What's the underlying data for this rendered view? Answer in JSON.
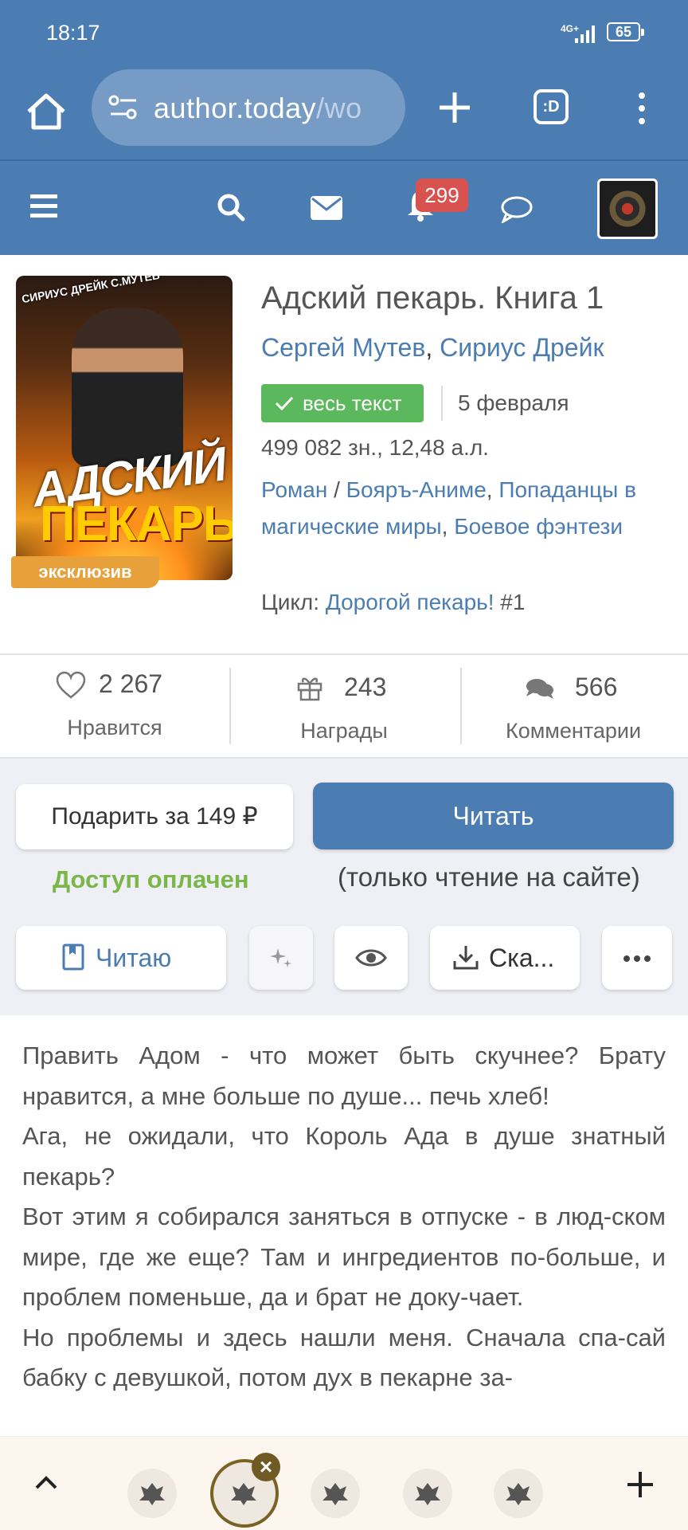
{
  "status_bar": {
    "time": "18:17",
    "network": "4G+",
    "battery": "65"
  },
  "browser": {
    "url_main": "author.today",
    "url_rest": "/wo",
    "ext_label": ":D"
  },
  "site_nav": {
    "notifications_count": "299"
  },
  "book": {
    "title": "Адский пекарь. Книга 1",
    "authors": [
      "Сергей Мутев",
      "Сириус Дрейк"
    ],
    "author_separator": ", ",
    "cover_badge": "эксклюзив",
    "cover_title_line1": "АДСКИЙ",
    "cover_title_line2": "ПЕКАРЬ",
    "cover_authors": "СИРИУС ДРЕЙК С.МУТЕВ",
    "status_badge": "весь текст",
    "date": "5 февраля",
    "size": "499 082 зн., 12,48 а.л.",
    "genre_main": "Роман",
    "genre_slash": " / ",
    "genre_1": "Бояръ-Аниме",
    "genre_2": "Попаданцы в магические миры",
    "genre_3": "Боевое фэнтези",
    "genre_comma": ", ",
    "cycle_label": "Цикл: ",
    "cycle_name": "Дорогой пекарь!",
    "cycle_number": " #1"
  },
  "stats": {
    "likes": {
      "value": "2 267",
      "label": "Нравится"
    },
    "awards": {
      "value": "243",
      "label": "Награды"
    },
    "comments": {
      "value": "566",
      "label": "Комментарии"
    }
  },
  "actions": {
    "gift": "Подарить за 149 ₽",
    "read": "Читать",
    "paid_status": "Доступ оплачен",
    "read_note": "(только чтение на сайте)",
    "reading": "Читаю",
    "download": "Ска..."
  },
  "description": [
    "Править Адом - что может быть скучнее? Брату нравится, а мне больше по душе... печь хлеб!",
    "Ага, не ожидали, что Король Ада в душе знатный пекарь?",
    "Вот этим я собирался заняться в отпуске - в люд-ском мире, где же еще? Там и ингредиентов по-больше, и проблем поменьше, да и брат не доку-чает.",
    "Но проблемы и здесь нашли меня. Сначала спа-сай бабку с девушкой, потом дух в пекарне за-"
  ],
  "colors": {
    "brand": "#4b7cb2",
    "success": "#5cb85c",
    "badge": "#d8534f",
    "exclusive": "#e8a13a",
    "paid": "#7ab648"
  }
}
